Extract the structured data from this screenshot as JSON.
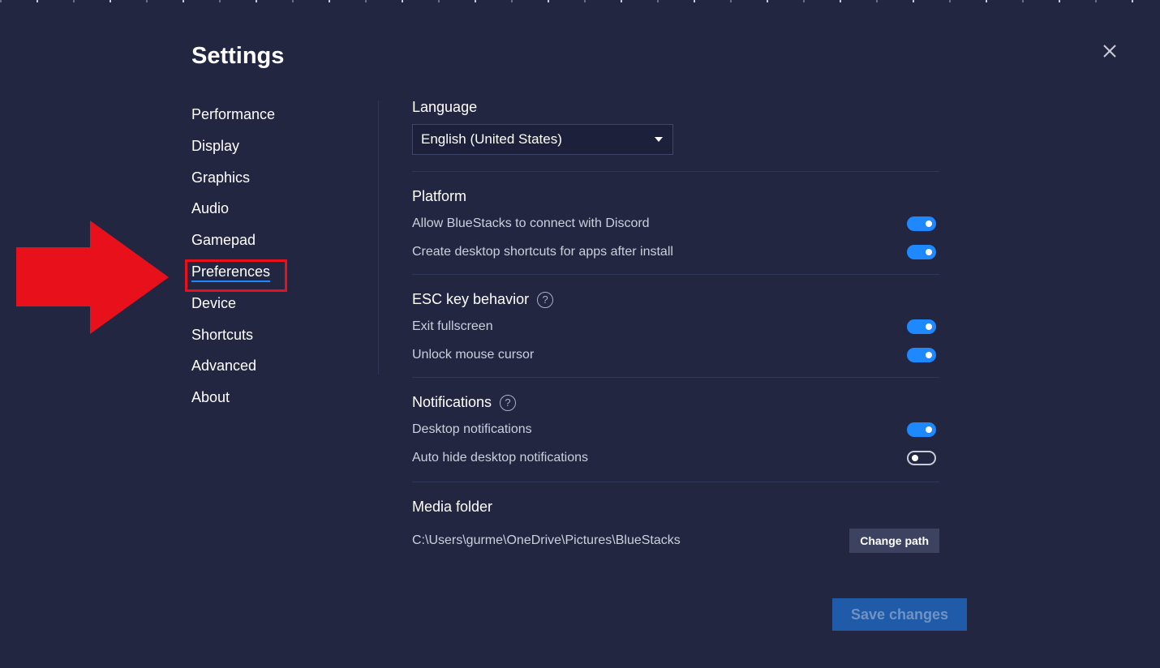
{
  "dialog": {
    "title": "Settings",
    "close_icon": "close-icon"
  },
  "nav": {
    "items": [
      {
        "label": "Performance"
      },
      {
        "label": "Display"
      },
      {
        "label": "Graphics"
      },
      {
        "label": "Audio"
      },
      {
        "label": "Gamepad"
      },
      {
        "label": "Preferences",
        "active": true
      },
      {
        "label": "Device"
      },
      {
        "label": "Shortcuts"
      },
      {
        "label": "Advanced"
      },
      {
        "label": "About"
      }
    ]
  },
  "language": {
    "title": "Language",
    "selected": "English (United States)"
  },
  "platform": {
    "title": "Platform",
    "options": [
      {
        "label": "Allow BlueStacks to connect with Discord",
        "on": true
      },
      {
        "label": "Create desktop shortcuts for apps after install",
        "on": true
      }
    ]
  },
  "esc": {
    "title": "ESC key behavior",
    "help": "?",
    "options": [
      {
        "label": "Exit fullscreen",
        "on": true
      },
      {
        "label": "Unlock mouse cursor",
        "on": true
      }
    ]
  },
  "notifications": {
    "title": "Notifications",
    "help": "?",
    "options": [
      {
        "label": "Desktop notifications",
        "on": true
      },
      {
        "label": "Auto hide desktop notifications",
        "on": false
      }
    ]
  },
  "media": {
    "title": "Media folder",
    "path": "C:\\Users\\gurme\\OneDrive\\Pictures\\BlueStacks",
    "change_label": "Change path"
  },
  "footer": {
    "save_label": "Save changes"
  },
  "colors": {
    "background": "#222640",
    "accent": "#1e88ff",
    "annotation_red": "#e8111b",
    "save_button": "#1f5ba8"
  }
}
